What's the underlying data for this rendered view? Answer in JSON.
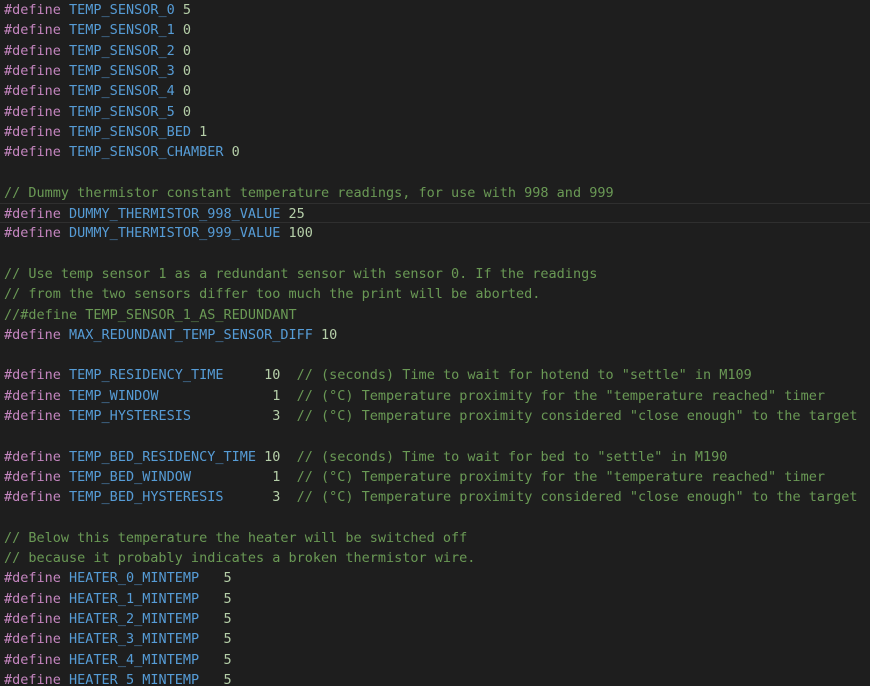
{
  "editor": {
    "lines": [
      {
        "kind": "define",
        "directive": "#define",
        "name": "TEMP_SENSOR_0",
        "gap": " ",
        "value": "5",
        "comment": ""
      },
      {
        "kind": "define",
        "directive": "#define",
        "name": "TEMP_SENSOR_1",
        "gap": " ",
        "value": "0",
        "comment": ""
      },
      {
        "kind": "define",
        "directive": "#define",
        "name": "TEMP_SENSOR_2",
        "gap": " ",
        "value": "0",
        "comment": ""
      },
      {
        "kind": "define",
        "directive": "#define",
        "name": "TEMP_SENSOR_3",
        "gap": " ",
        "value": "0",
        "comment": ""
      },
      {
        "kind": "define",
        "directive": "#define",
        "name": "TEMP_SENSOR_4",
        "gap": " ",
        "value": "0",
        "comment": ""
      },
      {
        "kind": "define",
        "directive": "#define",
        "name": "TEMP_SENSOR_5",
        "gap": " ",
        "value": "0",
        "comment": ""
      },
      {
        "kind": "define",
        "directive": "#define",
        "name": "TEMP_SENSOR_BED",
        "gap": " ",
        "value": "1",
        "comment": ""
      },
      {
        "kind": "define",
        "directive": "#define",
        "name": "TEMP_SENSOR_CHAMBER",
        "gap": " ",
        "value": "0",
        "comment": ""
      },
      {
        "kind": "blank"
      },
      {
        "kind": "comment",
        "text": "// Dummy thermistor constant temperature readings, for use with 998 and 999"
      },
      {
        "kind": "define",
        "directive": "#define",
        "name": "DUMMY_THERMISTOR_998_VALUE",
        "gap": " ",
        "value": "25",
        "comment": "",
        "active": true
      },
      {
        "kind": "define",
        "directive": "#define",
        "name": "DUMMY_THERMISTOR_999_VALUE",
        "gap": " ",
        "value": "100",
        "comment": ""
      },
      {
        "kind": "blank"
      },
      {
        "kind": "comment",
        "text": "// Use temp sensor 1 as a redundant sensor with sensor 0. If the readings"
      },
      {
        "kind": "comment",
        "text": "// from the two sensors differ too much the print will be aborted."
      },
      {
        "kind": "comment",
        "text": "//#define TEMP_SENSOR_1_AS_REDUNDANT"
      },
      {
        "kind": "define",
        "directive": "#define",
        "name": "MAX_REDUNDANT_TEMP_SENSOR_DIFF",
        "gap": " ",
        "value": "10",
        "comment": ""
      },
      {
        "kind": "blank"
      },
      {
        "kind": "define",
        "directive": "#define",
        "name": "TEMP_RESIDENCY_TIME",
        "gap": "     ",
        "value": "10",
        "comment": "  // (seconds) Time to wait for hotend to \"settle\" in M109"
      },
      {
        "kind": "define",
        "directive": "#define",
        "name": "TEMP_WINDOW",
        "gap": "              ",
        "value": "1",
        "comment": "  // (°C) Temperature proximity for the \"temperature reached\" timer"
      },
      {
        "kind": "define",
        "directive": "#define",
        "name": "TEMP_HYSTERESIS",
        "gap": "          ",
        "value": "3",
        "comment": "  // (°C) Temperature proximity considered \"close enough\" to the target"
      },
      {
        "kind": "blank"
      },
      {
        "kind": "define",
        "directive": "#define",
        "name": "TEMP_BED_RESIDENCY_TIME",
        "gap": " ",
        "value": "10",
        "comment": "  // (seconds) Time to wait for bed to \"settle\" in M190"
      },
      {
        "kind": "define",
        "directive": "#define",
        "name": "TEMP_BED_WINDOW",
        "gap": "          ",
        "value": "1",
        "comment": "  // (°C) Temperature proximity for the \"temperature reached\" timer"
      },
      {
        "kind": "define",
        "directive": "#define",
        "name": "TEMP_BED_HYSTERESIS",
        "gap": "      ",
        "value": "3",
        "comment": "  // (°C) Temperature proximity considered \"close enough\" to the target"
      },
      {
        "kind": "blank"
      },
      {
        "kind": "comment",
        "text": "// Below this temperature the heater will be switched off"
      },
      {
        "kind": "comment",
        "text": "// because it probably indicates a broken thermistor wire."
      },
      {
        "kind": "define",
        "directive": "#define",
        "name": "HEATER_0_MINTEMP",
        "gap": "   ",
        "value": "5",
        "comment": ""
      },
      {
        "kind": "define",
        "directive": "#define",
        "name": "HEATER_1_MINTEMP",
        "gap": "   ",
        "value": "5",
        "comment": ""
      },
      {
        "kind": "define",
        "directive": "#define",
        "name": "HEATER_2_MINTEMP",
        "gap": "   ",
        "value": "5",
        "comment": ""
      },
      {
        "kind": "define",
        "directive": "#define",
        "name": "HEATER_3_MINTEMP",
        "gap": "   ",
        "value": "5",
        "comment": ""
      },
      {
        "kind": "define",
        "directive": "#define",
        "name": "HEATER_4_MINTEMP",
        "gap": "   ",
        "value": "5",
        "comment": ""
      },
      {
        "kind": "define",
        "directive": "#define",
        "name": "HEATER_5_MINTEMP",
        "gap": "   ",
        "value": "5",
        "comment": ""
      }
    ]
  },
  "colors": {
    "background": "#1e1e1e",
    "directive": "#c586c0",
    "macro_name": "#569cd6",
    "number": "#b5cea8",
    "comment": "#6a9955",
    "text": "#d4d4d4"
  }
}
